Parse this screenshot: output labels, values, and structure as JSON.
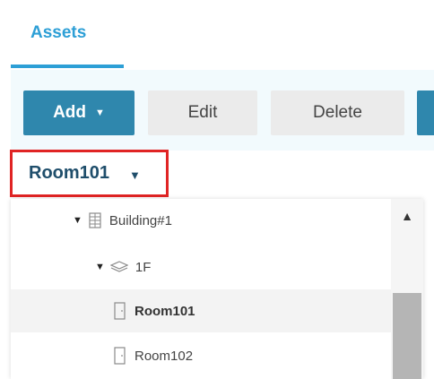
{
  "tabs": [
    {
      "label": "Assets",
      "active": true
    }
  ],
  "toolbar": {
    "add_label": "Add",
    "add_caret": "▼",
    "edit_label": "Edit",
    "delete_label": "Delete"
  },
  "selector": {
    "value": "Room101",
    "caret": "▼",
    "highlight_color": "#e02424"
  },
  "tree": {
    "items": [
      {
        "label": "Building#1",
        "icon": "building-icon",
        "expanded": true,
        "toggle": "▼",
        "selected": false
      },
      {
        "label": "1F",
        "icon": "floor-layers-icon",
        "expanded": true,
        "toggle": "▼",
        "selected": false
      },
      {
        "label": "Room101",
        "icon": "room-door-icon",
        "selected": true
      },
      {
        "label": "Room102",
        "icon": "room-door-icon",
        "selected": false
      }
    ]
  },
  "scrollbar": {
    "up_glyph": "▲"
  },
  "colors": {
    "accent": "#2d9fd6",
    "primary_button": "#2f87ad",
    "secondary_button": "#ebebeb",
    "selector_text": "#1f4e6b",
    "toolbar_band": "#f2fafd"
  }
}
